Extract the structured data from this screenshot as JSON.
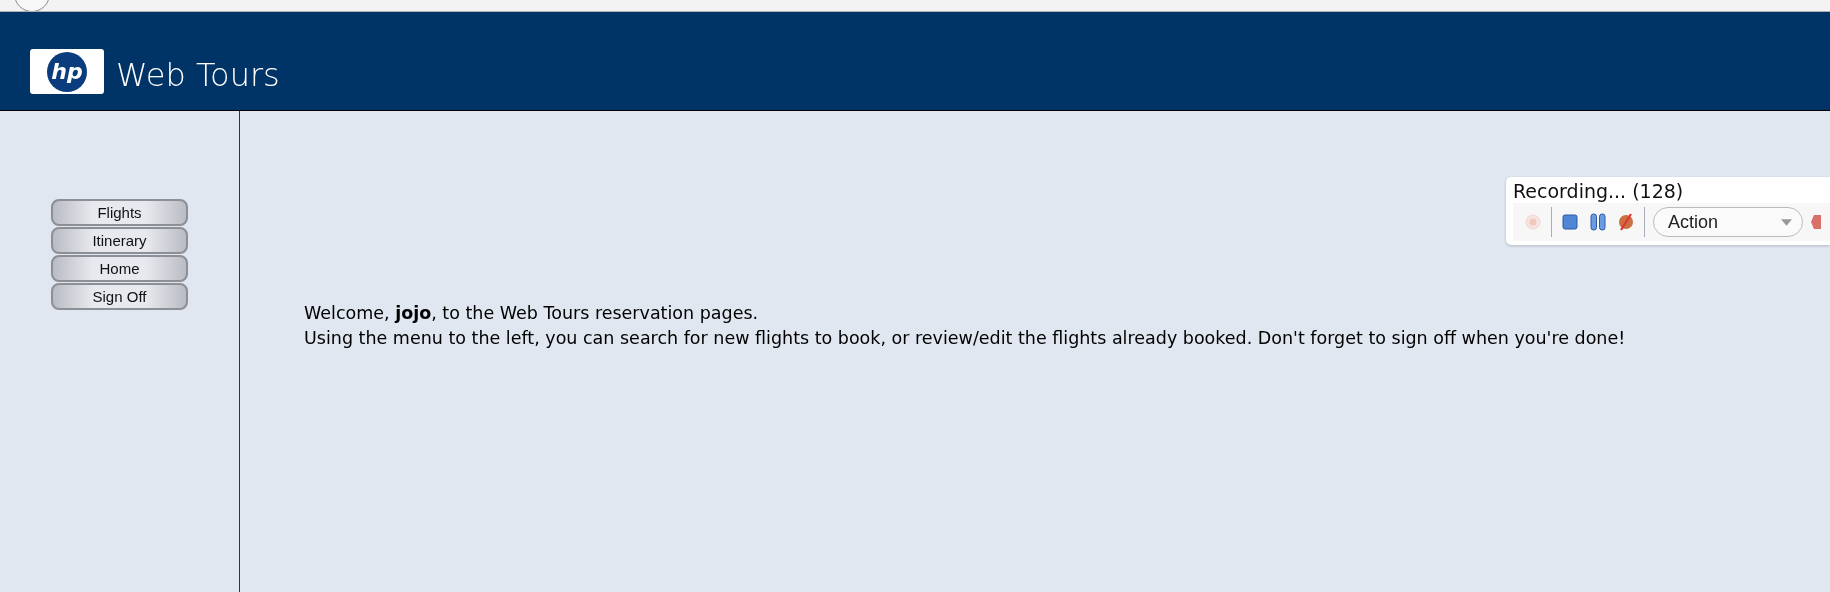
{
  "header": {
    "logo_text": "hp",
    "title": "Web Tours"
  },
  "menu": [
    {
      "label": "Flights"
    },
    {
      "label": "Itinerary"
    },
    {
      "label": "Home"
    },
    {
      "label": "Sign Off"
    }
  ],
  "recorder": {
    "status": "Recording... (128)",
    "action": "Action",
    "record_disabled": true
  },
  "welcome": [
    "Welcome, **jojo**, to the Web Tours reservation pages.",
    "Using the menu to the left, you can search for new flights to book, or review/edit the flights already booked. Don't forget to sign off when you're done!"
  ]
}
